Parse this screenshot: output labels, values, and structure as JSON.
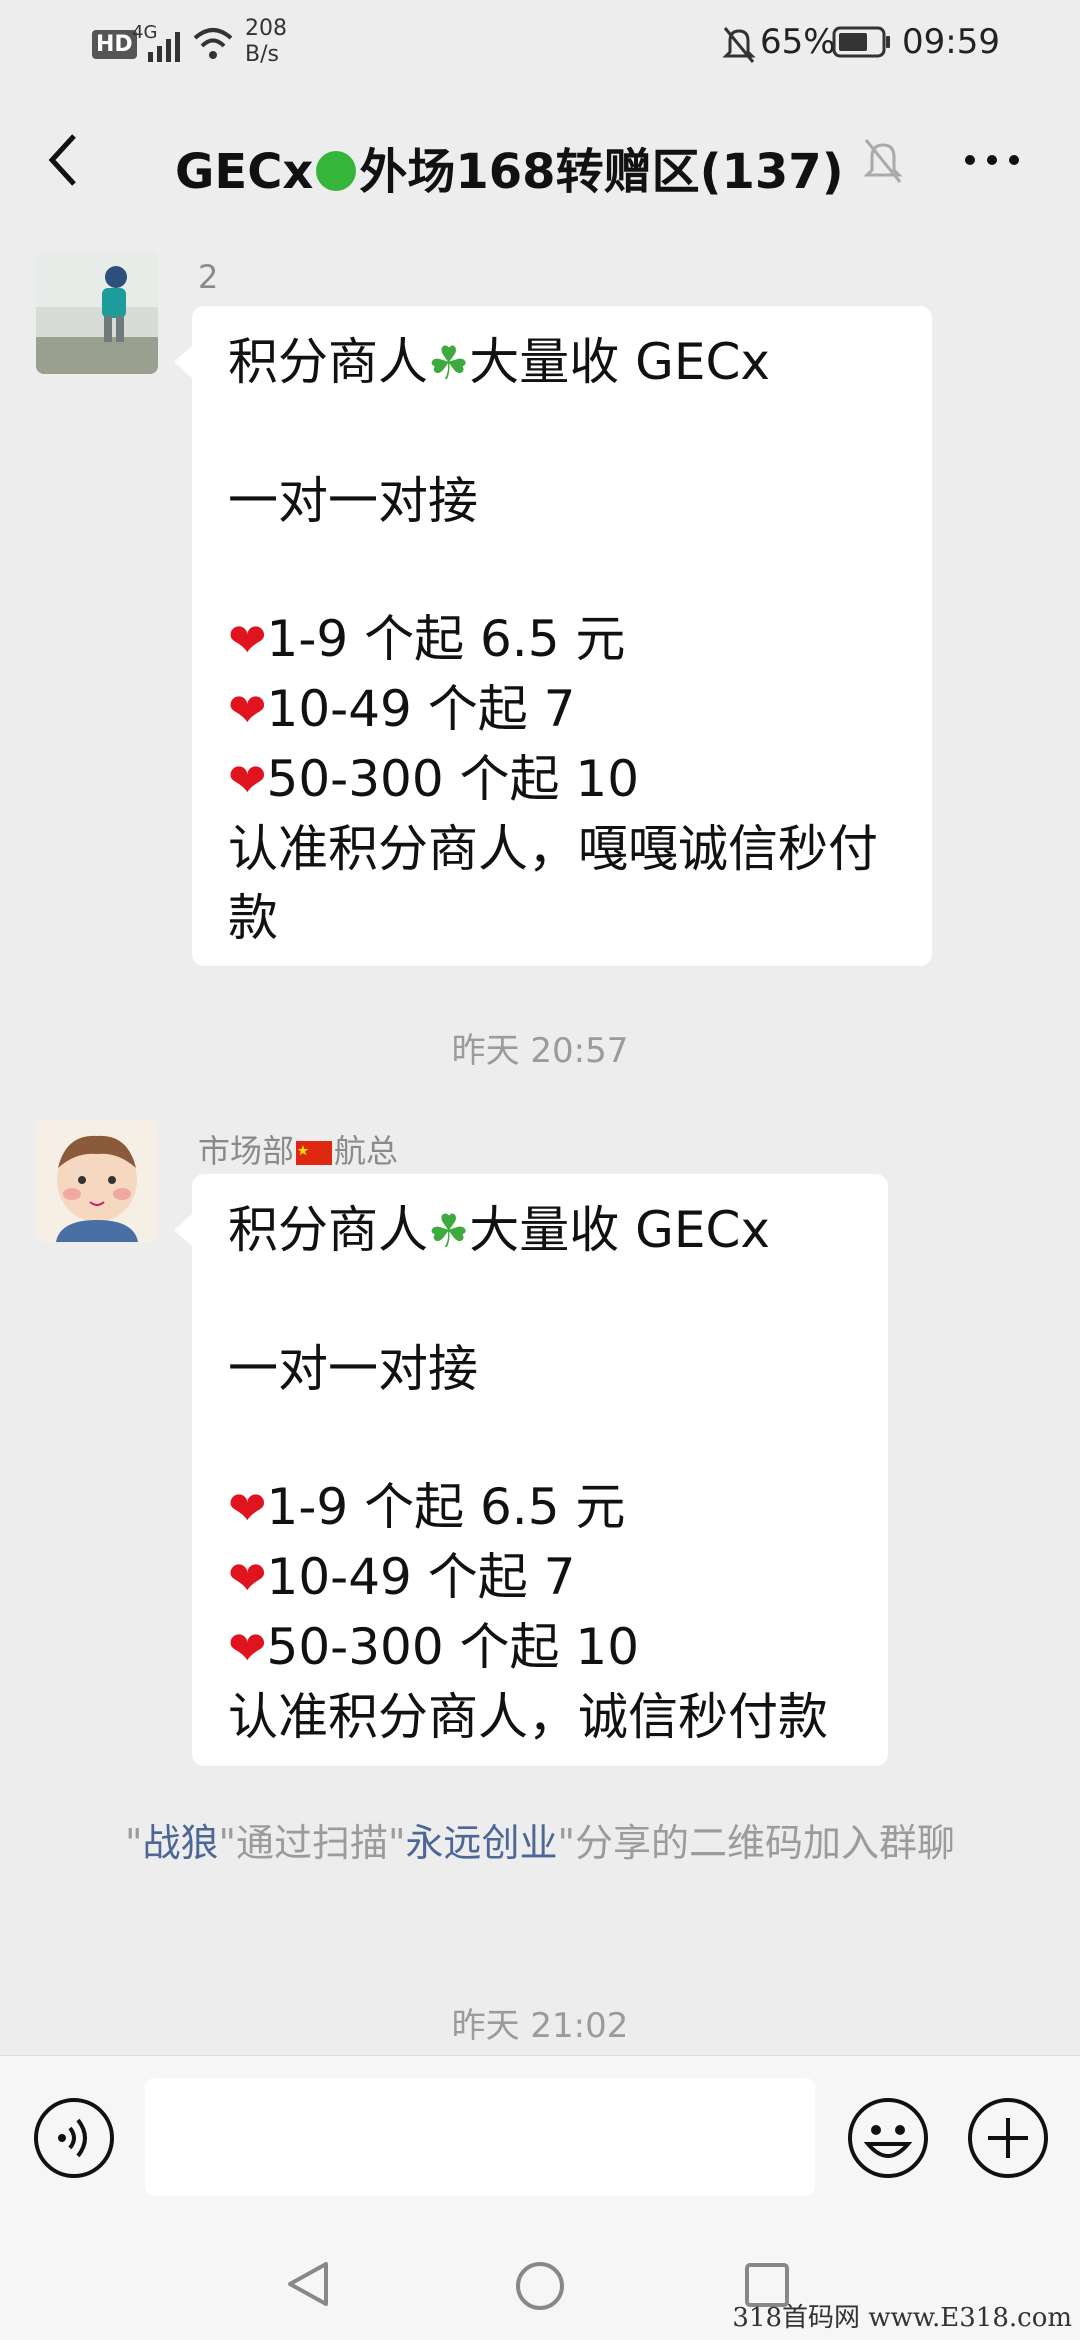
{
  "status_bar": {
    "network_badge": "HD",
    "signal": "4G",
    "speed_value": "208",
    "speed_unit": "B/s",
    "battery": "65%",
    "time": "09:59"
  },
  "header": {
    "title_prefix": "GECx",
    "title_suffix": "外场168转赠区(137)"
  },
  "messages": [
    {
      "sender": "2",
      "lines": {
        "title_a": "积分商人",
        "title_b": "大量收 GECx",
        "subtitle": "一对一对接",
        "price_1": "1-9 个起 6.5 元",
        "price_2": "10-49 个起 7",
        "price_3": "50-300 个起 10",
        "closing": "认准积分商人，嘎嘎诚信秒付款"
      }
    },
    {
      "sender_a": "市场部",
      "sender_b": "航总",
      "lines": {
        "title_a": "积分商人",
        "title_b": "大量收 GECx",
        "subtitle": "一对一对接",
        "price_1": "1-9 个起 6.5 元",
        "price_2": "10-49 个起 7",
        "price_3": "50-300 个起 10",
        "closing": "认准积分商人，诚信秒付款"
      }
    }
  ],
  "timestamps": {
    "first": "昨天 20:57",
    "second": "昨天 21:02"
  },
  "system_message": {
    "q1": "\"",
    "user": "战狼",
    "mid": "\"通过扫描\"",
    "inviter": "永远创业",
    "tail": "\"分享的二维码加入群聊"
  },
  "input": {
    "value": ""
  },
  "watermark": "318首码网 www.E318.com",
  "colors": {
    "background": "#ededed",
    "bubble": "#ffffff",
    "link": "#4c6797",
    "heart": "#e0141e"
  },
  "icons": [
    "back-icon",
    "mute-bell-icon",
    "more-icon",
    "voice-icon",
    "emoji-icon",
    "plus-icon",
    "nav-back-icon",
    "nav-home-icon",
    "nav-recents-icon",
    "heart-icon",
    "clover-icon",
    "china-flag-icon",
    "green-circle-icon"
  ]
}
